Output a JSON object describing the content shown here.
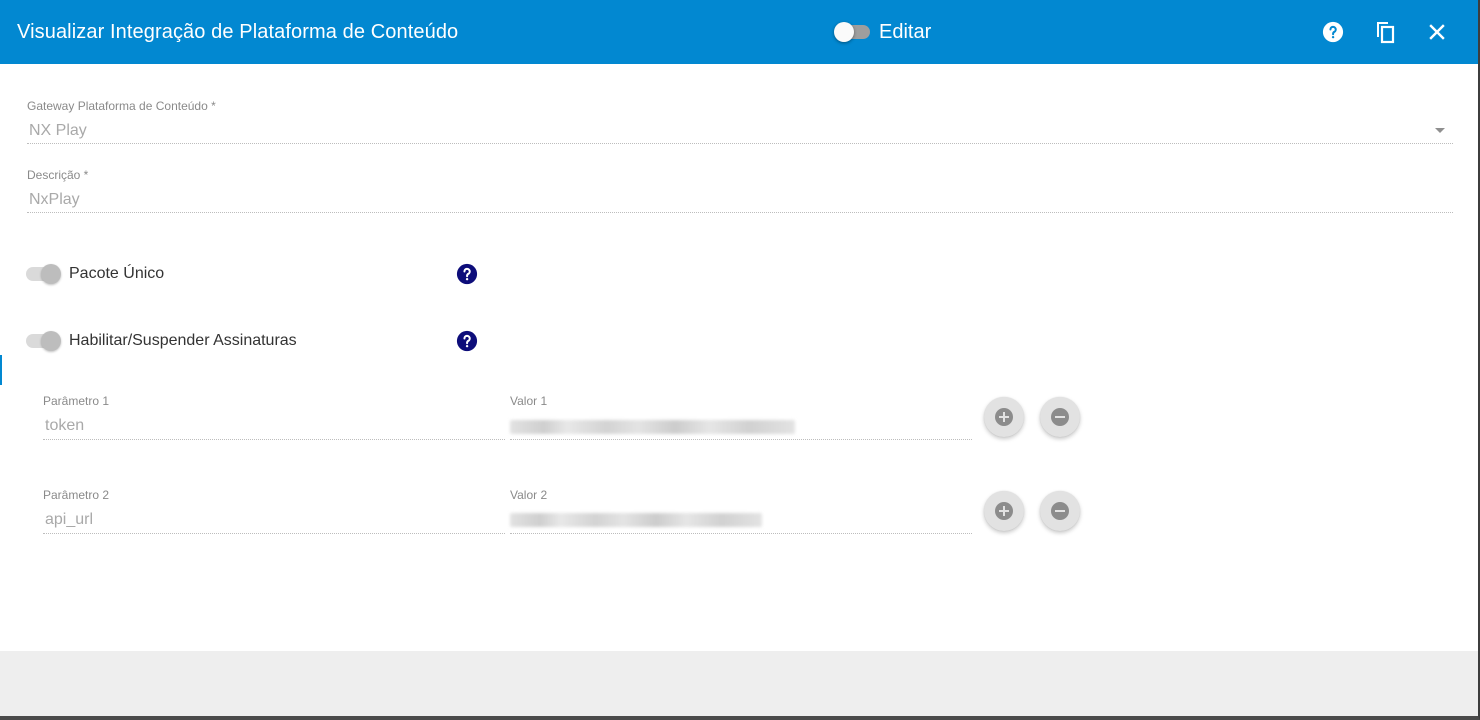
{
  "header": {
    "title": "Visualizar Integração de Plataforma de Conteúdo",
    "edit_label": "Editar",
    "edit_enabled": false,
    "color": "#0288d1",
    "icons": [
      "help-icon",
      "copy-icon",
      "close-icon"
    ]
  },
  "form": {
    "gateway": {
      "label": "Gateway Plataforma de Conteúdo *",
      "value": "NX Play"
    },
    "description": {
      "label": "Descrição *",
      "value": "NxPlay"
    },
    "switches": [
      {
        "label": "Pacote Único",
        "enabled": false
      },
      {
        "label": "Habilitar/Suspender Assinaturas",
        "enabled": false
      }
    ],
    "parameters": [
      {
        "param_label": "Parâmetro 1",
        "param_value": "token",
        "value_label": "Valor 1",
        "value_redacted": true
      },
      {
        "param_label": "Parâmetro 2",
        "param_value": "api_url",
        "value_label": "Valor 2",
        "value_redacted": true
      }
    ]
  },
  "help_icon_color": "#0d0d7a"
}
